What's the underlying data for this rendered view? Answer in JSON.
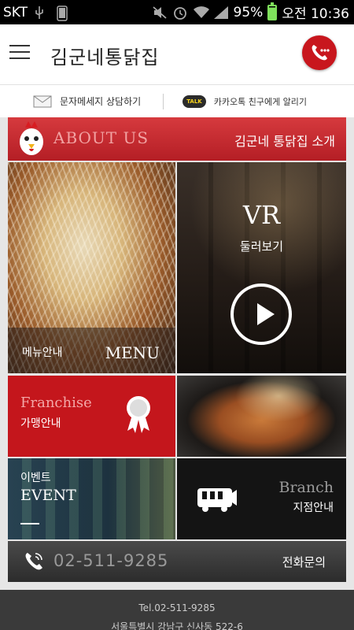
{
  "status_bar": {
    "carrier": "SKT",
    "battery": "95%",
    "time": "오전 10:36",
    "icons": [
      "usb-icon",
      "screenshot-icon",
      "mute-icon",
      "alarm-icon",
      "wifi-icon",
      "signal-icon",
      "battery-icon"
    ]
  },
  "header": {
    "brand": "김군네통닭집",
    "menu_icon": "hamburger-icon",
    "call_icon": "phone-icon"
  },
  "subbar": {
    "sms_label": "문자메세지 상담하기",
    "kakao_badge": "TALK",
    "kakao_label": "카카오톡 친구에게 알리기"
  },
  "about": {
    "title": "ABOUT US",
    "subtitle": "김군네 통닭집 소개"
  },
  "tiles": {
    "menu": {
      "ko": "메뉴안내",
      "en": "MENU"
    },
    "vr": {
      "title": "VR",
      "subtitle": "둘러보기"
    },
    "franchise": {
      "en": "Franchise",
      "ko": "가맹안내"
    },
    "event": {
      "ko": "이벤트",
      "en": "EVENT"
    },
    "branch": {
      "en": "Branch",
      "ko": "지점안내"
    }
  },
  "phone_bar": {
    "number": "02-511-9285",
    "label": "전화문의"
  },
  "footer": {
    "tel": "Tel.02-511-9285",
    "address": "서울특별시 강남구 신사동 522-6"
  },
  "colors": {
    "brand_red": "#c4161c",
    "dark": "#141414"
  }
}
